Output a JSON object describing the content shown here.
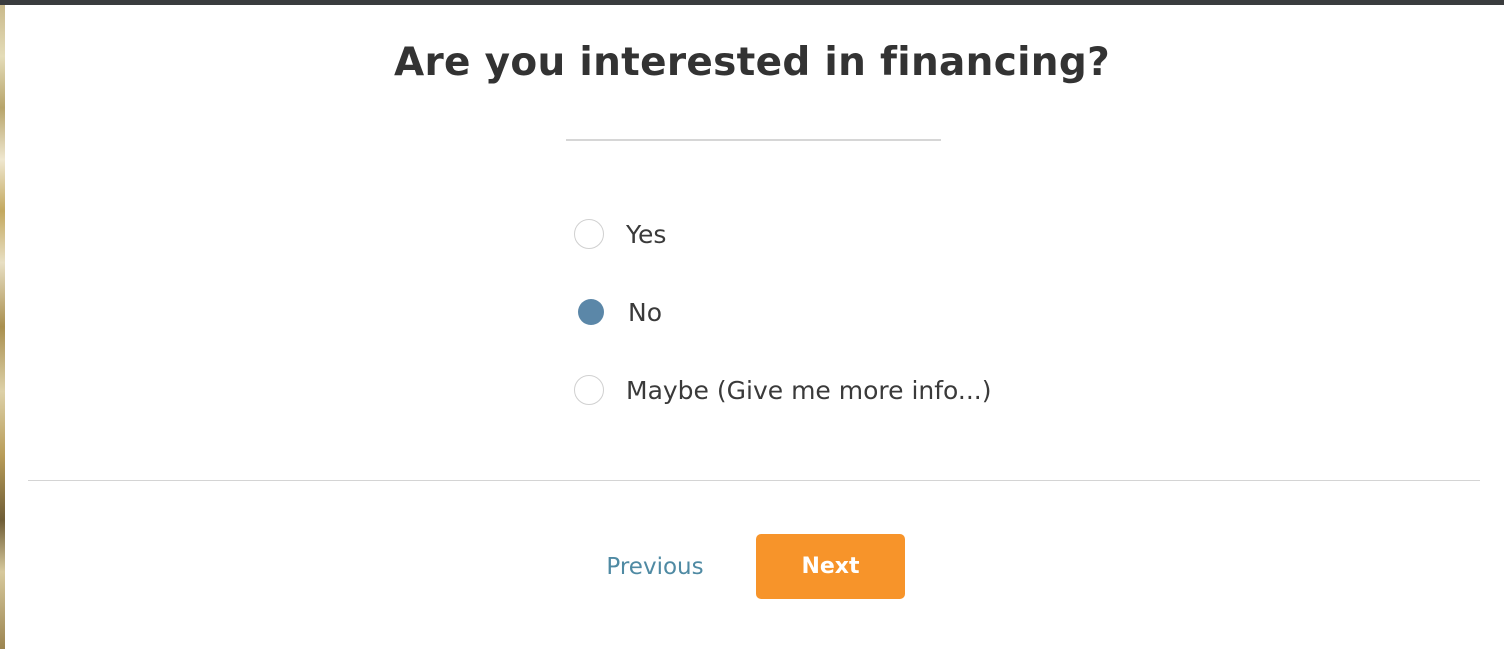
{
  "form": {
    "question": "Are you interested in financing?",
    "options": [
      {
        "label": "Yes",
        "selected": false
      },
      {
        "label": "No",
        "selected": true
      },
      {
        "label": "Maybe (Give me more info...)",
        "selected": false
      }
    ]
  },
  "navigation": {
    "previous_label": "Previous",
    "next_label": "Next"
  },
  "colors": {
    "accent": "#f7942a",
    "link": "#4f8aa3",
    "radio_selected": "#5b87a8",
    "top_bar": "#3a3c3e"
  }
}
